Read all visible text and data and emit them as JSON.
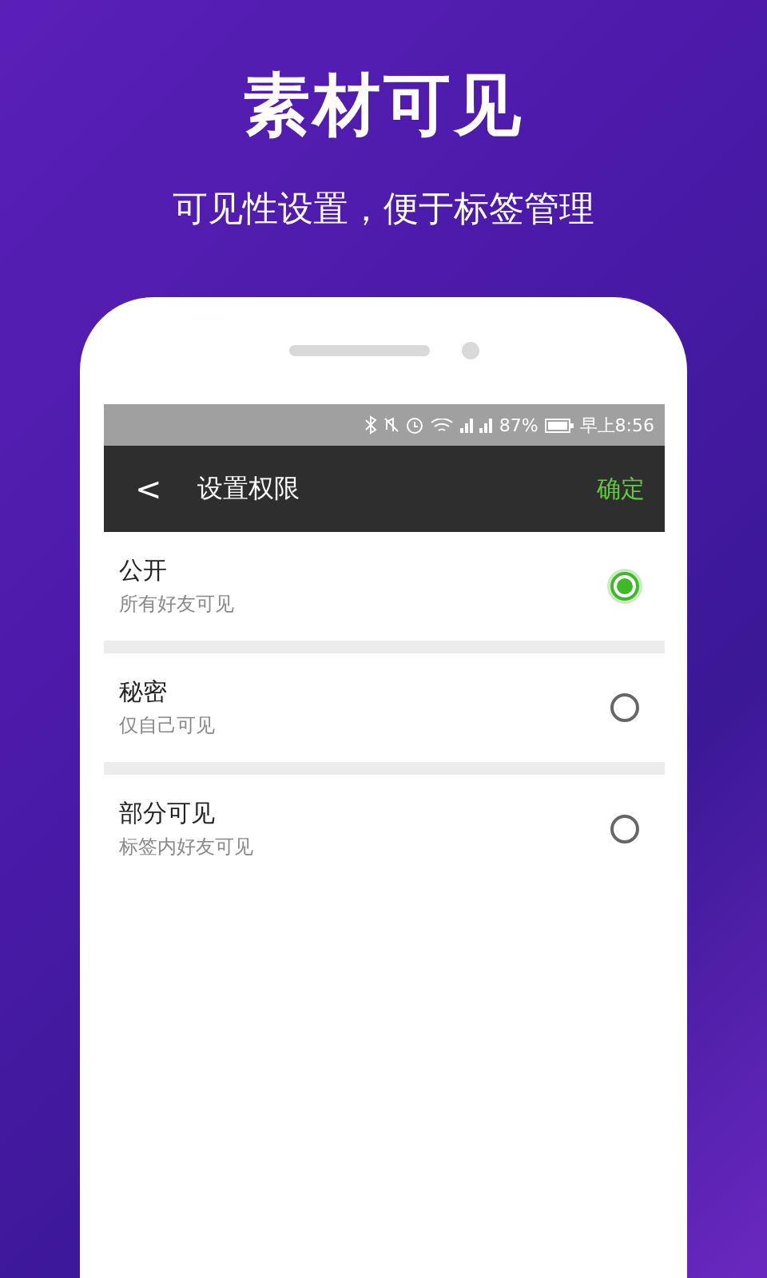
{
  "headline": "素材可见",
  "subtitle": "可见性设置，便于标签管理",
  "status_bar": {
    "battery": "87%",
    "time": "早上8:56"
  },
  "header": {
    "back": "<",
    "title": "设置权限",
    "action": "确定"
  },
  "options": [
    {
      "label": "公开",
      "description": "所有好友可见",
      "selected": true
    },
    {
      "label": "秘密",
      "description": "仅自己可见",
      "selected": false
    },
    {
      "label": "部分可见",
      "description": "标签内好友可见",
      "selected": false
    }
  ]
}
